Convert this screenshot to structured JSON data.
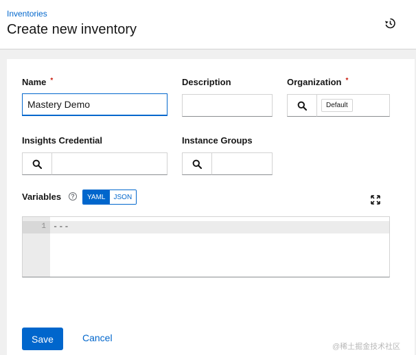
{
  "header": {
    "breadcrumb": "Inventories",
    "title": "Create new inventory"
  },
  "form": {
    "name": {
      "label": "Name",
      "required_mark": "*",
      "value": "Mastery Demo"
    },
    "description": {
      "label": "Description",
      "value": ""
    },
    "organization": {
      "label": "Organization",
      "required_mark": "*",
      "selected": "Default"
    },
    "insights_credential": {
      "label": "Insights Credential",
      "value": ""
    },
    "instance_groups": {
      "label": "Instance Groups",
      "value": ""
    },
    "variables": {
      "label": "Variables",
      "help_glyph": "?",
      "modes": [
        "YAML",
        "JSON"
      ],
      "active_mode": "YAML",
      "line_number": "1",
      "content": "---"
    }
  },
  "actions": {
    "save_label": "Save",
    "cancel_label": "Cancel"
  },
  "watermark": "@稀土掘金技术社区",
  "icons": {
    "history": "history-icon",
    "search": "search-icon",
    "help": "question-circle-icon",
    "expand": "expand-icon"
  },
  "colors": {
    "primary": "#0066cc",
    "required": "#c9190b"
  }
}
